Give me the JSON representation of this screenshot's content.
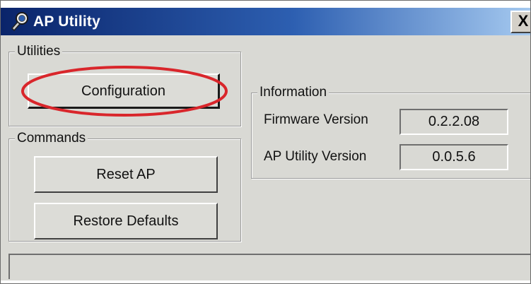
{
  "window": {
    "title": "AP Utility",
    "close_glyph": "X",
    "title_icon": "wrench-magnifier-icon",
    "colors": {
      "titlebar_start": "#0a246a",
      "titlebar_end": "#a6caf0",
      "face": "#d9d9d4",
      "highlight_ellipse": "#d9262b"
    }
  },
  "utilities": {
    "group_label": "Utilities",
    "configuration_label": "Configuration"
  },
  "commands": {
    "group_label": "Commands",
    "reset_label": "Reset AP",
    "restore_label": "Restore Defaults"
  },
  "information": {
    "group_label": "Information",
    "firmware_label": "Firmware Version",
    "firmware_value": "0.2.2.08",
    "ap_utility_label": "AP Utility Version",
    "ap_utility_value": "0.0.5.6"
  },
  "status_bar": {
    "text": ""
  }
}
